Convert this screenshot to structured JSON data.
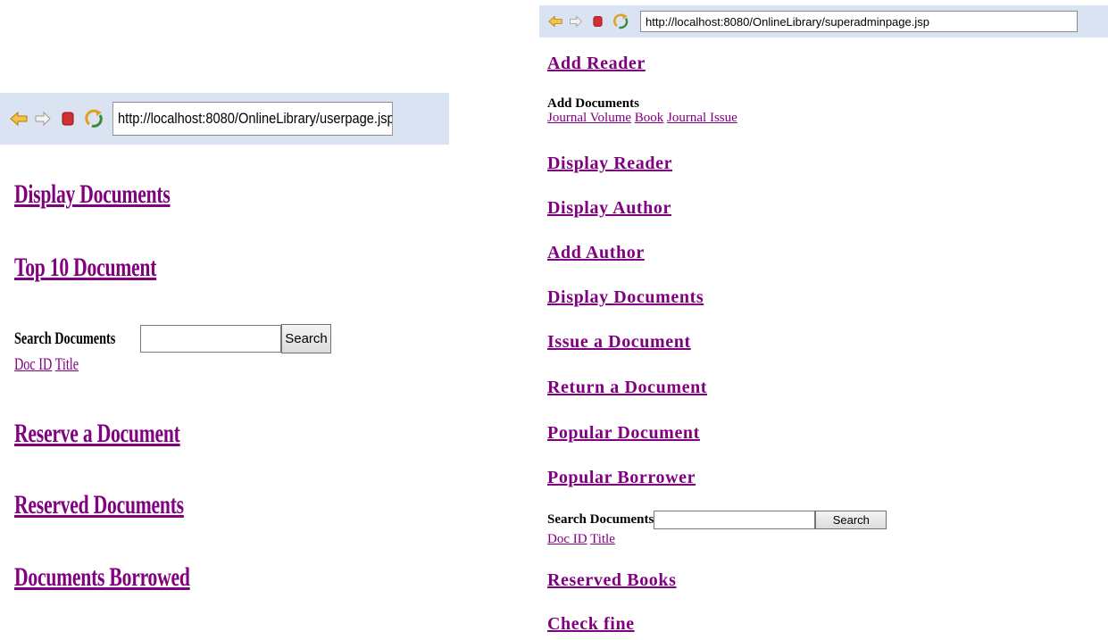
{
  "left": {
    "address": "http://localhost:8080/OnlineLibrary/userpage.jsp",
    "links": {
      "display_documents": "Display Documents",
      "top_10": "Top 10 Document",
      "reserve": "Reserve a Document",
      "reserved": "Reserved Documents",
      "borrowed": "Documents Borrowed"
    },
    "search": {
      "label": "Search Documents",
      "button": "Search",
      "doc_id": "Doc ID",
      "title": "Title"
    }
  },
  "right": {
    "address": "http://localhost:8080/OnlineLibrary/superadminpage.jsp",
    "links": {
      "add_reader": "Add Reader",
      "display_reader": "Display Reader",
      "display_author": "Display Author",
      "add_author": "Add Author",
      "display_documents": "Display Documents",
      "issue": "Issue a Document",
      "return": "Return a Document",
      "popular_document": "Popular Document",
      "popular_borrower": "Popular Borrower",
      "reserved_books": "Reserved Books",
      "check_fine": "Check fine"
    },
    "add_documents": {
      "heading": "Add Documents",
      "journal_volume": "Journal Volume",
      "book": "Book",
      "journal_issue": "Journal Issue"
    },
    "search": {
      "label": "Search Documents",
      "button": "Search",
      "doc_id": "Doc ID",
      "title": "Title"
    }
  },
  "colors": {
    "link": "#800080",
    "toolbar": "#d9e3f2",
    "stop": "#d32f2f",
    "arrow": "#f5c242"
  }
}
